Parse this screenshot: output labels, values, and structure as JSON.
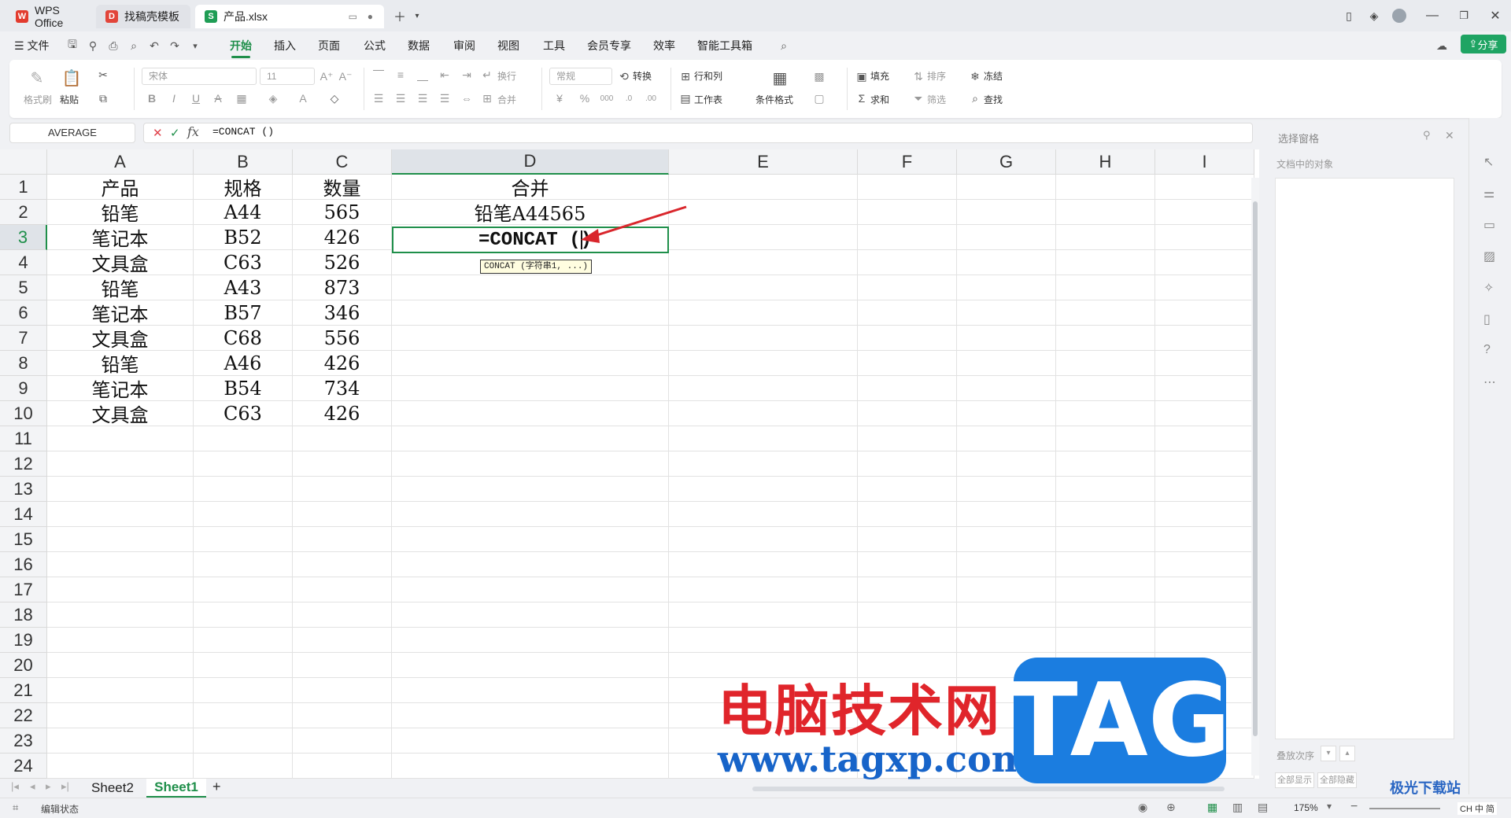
{
  "tabs": [
    {
      "label": "WPS Office",
      "icon": "wps-logo-icon"
    },
    {
      "label": "找稿壳模板",
      "icon": "template-icon"
    },
    {
      "label": "产品.xlsx",
      "icon": "sheet-s-icon"
    }
  ],
  "menu": {
    "file": "文件",
    "items": [
      "开始",
      "插入",
      "页面",
      "公式",
      "数据",
      "审阅",
      "视图",
      "工具",
      "会员专享",
      "效率",
      "智能工具箱"
    ],
    "active": "开始",
    "share": "分享"
  },
  "ribbon": {
    "format_painter": "格式刷",
    "paste": "粘贴",
    "font_name": "宋体",
    "font_size": "11",
    "wrap": "换行",
    "merge": "合并",
    "number_format": "常规",
    "convert": "转换",
    "rows_cols": "行和列",
    "worksheet": "工作表",
    "cond_format": "条件格式",
    "fill": "填充",
    "sort": "排序",
    "freeze": "冻结",
    "sum": "求和",
    "filter": "筛选",
    "find": "查找"
  },
  "formula_bar": {
    "name_box": "AVERAGE",
    "formula": "=CONCAT ()"
  },
  "grid": {
    "columns": [
      "A",
      "B",
      "C",
      "D",
      "E",
      "F",
      "G",
      "H",
      "I"
    ],
    "row_numbers": [
      "1",
      "2",
      "3",
      "4",
      "5",
      "6",
      "7",
      "8",
      "9",
      "10",
      "11",
      "12",
      "13",
      "14",
      "15",
      "16",
      "17",
      "18",
      "19",
      "20",
      "21",
      "22",
      "23",
      "24"
    ],
    "rows": [
      [
        "产品",
        "规格",
        "数量",
        "合并"
      ],
      [
        "铅笔",
        "A44",
        "565",
        "铅笔A44565"
      ],
      [
        "笔记本",
        "B52",
        "426",
        ""
      ],
      [
        "文具盒",
        "C63",
        "526",
        ""
      ],
      [
        "铅笔",
        "A43",
        "873",
        ""
      ],
      [
        "笔记本",
        "B57",
        "346",
        ""
      ],
      [
        "文具盒",
        "C68",
        "556",
        ""
      ],
      [
        "铅笔",
        "A46",
        "426",
        ""
      ],
      [
        "笔记本",
        "B54",
        "734",
        ""
      ],
      [
        "文具盒",
        "C63",
        "426",
        ""
      ]
    ],
    "active_cell_text": "=CONCAT ()",
    "tooltip": "CONCAT (字符串1, ...)"
  },
  "right_pane": {
    "title": "选择窗格",
    "subtitle": "文档中的对象",
    "order_label": "叠放次序",
    "show_all": "全部显示",
    "hide_all": "全部隐藏"
  },
  "sheets": [
    "Sheet2",
    "Sheet1"
  ],
  "active_sheet": "Sheet1",
  "status": {
    "mode": "编辑状态",
    "zoom": "175%",
    "ime": "CH 中 简"
  },
  "watermarks": {
    "site_cn": "电脑技术网",
    "site_url": "www.tagxp.com",
    "tag": "TAG",
    "jiguang": "极光下载站"
  }
}
